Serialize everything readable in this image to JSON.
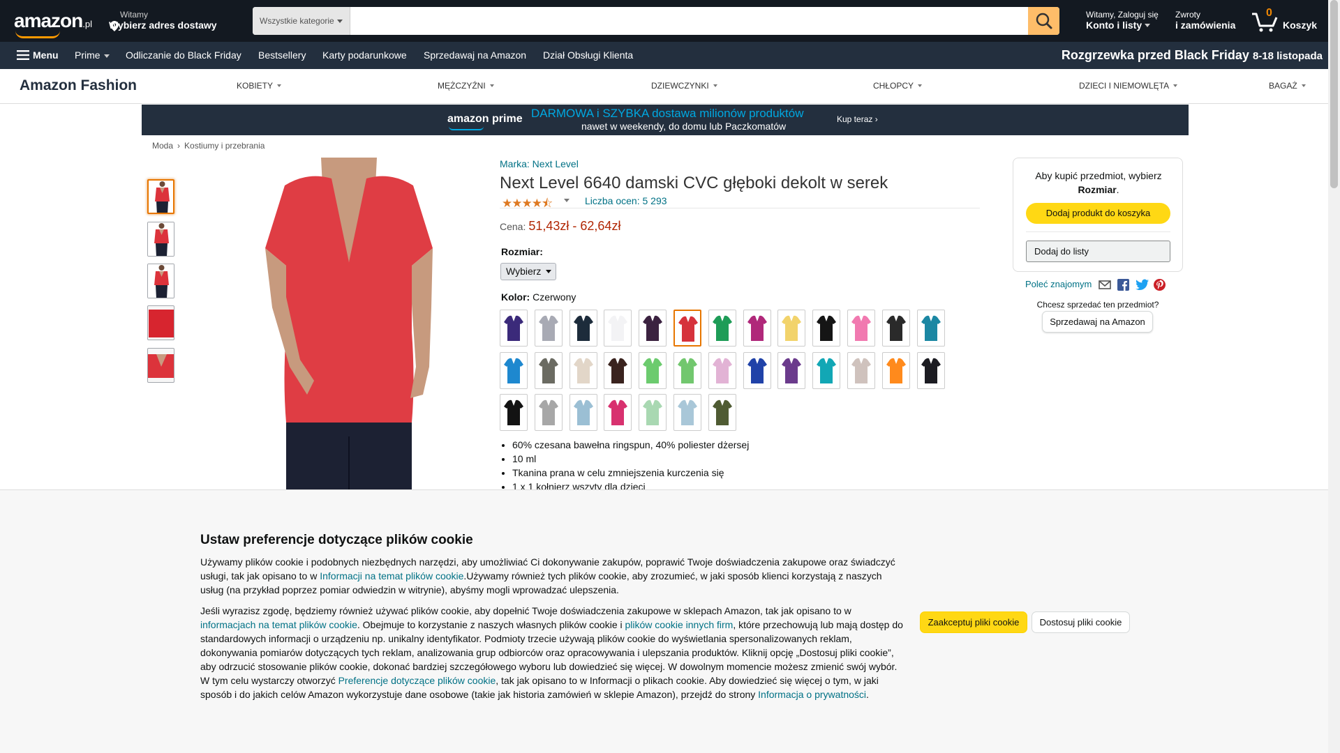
{
  "header": {
    "logo": "amazon",
    "logo_tld": ".pl",
    "deliver_line1": "Witamy",
    "deliver_line2": "Wybierz adres dostawy",
    "search_category": "Wszystkie kategorie",
    "search_placeholder": "",
    "account_line1": "Witamy, Zaloguj się",
    "account_line2": "Konto i listy",
    "returns_line1": "Zwroty",
    "returns_line2": "i zamówienia",
    "cart_count": "0",
    "cart_label": "Koszyk"
  },
  "nav": {
    "menu": "Menu",
    "items": [
      "Prime",
      "Odliczanie do Black Friday",
      "Bestsellery",
      "Karty podarunkowe",
      "Sprzedawaj na Amazon",
      "Dział Obsługi Klienta"
    ],
    "promo": "Rozgrzewka przed Black Friday",
    "promo_dates": "8-18 listopada"
  },
  "fashion": {
    "brand": "Amazon Fashion",
    "categories": [
      "KOBIETY",
      "MĘŻCZYŹNI",
      "DZIEWCZYNKI",
      "CHŁOPCY",
      "DZIECI I NIEMOWLĘTA",
      "BAGAŻ"
    ]
  },
  "prime_banner": {
    "logo": "amazon prime",
    "line1": "DARMOWA i SZYBKA dostawa milionów produktów",
    "line2": "nawet w weekendy, do domu lub Paczkomatów",
    "cta": "Kup teraz ›"
  },
  "breadcrumb": [
    "Moda",
    "Kostiumy i przebrania"
  ],
  "product": {
    "brand_link": "Marka: Next Level",
    "title": "Next Level 6640 damski CVC głęboki dekolt w serek",
    "stars": "★★★★⯪",
    "rating_count": "Liczba ocen: 5 293",
    "price_label": "Cena:",
    "price": "51,43zł - 62,64zł",
    "size_label": "Rozmiar:",
    "size_value": "Wybierz",
    "color_label": "Kolor:",
    "color_value": "Czerwony",
    "swatches": [
      "#3b2a7a",
      "#a8aab4",
      "#1d2c3b",
      "#f3f3f5",
      "#3b2240",
      "#d6323c",
      "#1e9c57",
      "#b0287a",
      "#f2d36b",
      "#151515",
      "#f179b0",
      "#2a2a2a",
      "#1b87a3",
      "#1e88cf",
      "#6b6b62",
      "#e2d6c8",
      "#3a231e",
      "#6ccb6e",
      "#72c76e",
      "#e2b3d5",
      "#2042a8",
      "#6b3b8c",
      "#12a7b5",
      "#cfc2bd",
      "#ff8a1c",
      "#1c1c22",
      "#131313",
      "#a7a7a7",
      "#9bbfd4",
      "#d8316f",
      "#a9d8b2",
      "#a9c7d8",
      "#4f5b33"
    ],
    "bullets": [
      "60% czesana bawełna ringspun, 40% poliester dżersej",
      "10 ml",
      "Tkanina prana w celu zmniejszenia kurczenia się",
      "1 x 1 kołnierz wszyty dla dzieci"
    ]
  },
  "buybox": {
    "line1": "Aby kupić przedmiot, wybierz",
    "line2": "Rozmiar",
    "add_to_cart": "Dodaj produkt do koszyka",
    "add_to_list": "Dodaj do listy",
    "share": "Poleć znajomym",
    "sell_question": "Chcesz sprzedać ten przedmiot?",
    "sell_button": "Sprzedawaj na Amazon"
  },
  "cookie": {
    "title": "Ustaw preferencje dotyczące plików cookie",
    "p1a": "Używamy plików cookie i podobnych niezbędnych narzędzi, aby umożliwiać Ci dokonywanie zakupów, poprawić Twoje doświadczenia zakupowe oraz świadczyć usługi, tak jak opisano to w ",
    "p1link": "Informacji na temat plików cookie",
    "p1b": ".Używamy również tych plików cookie, aby zrozumieć, w jaki sposób klienci korzystają z naszych usług (na przykład poprzez pomiar odwiedzin w witrynie), abyśmy mogli wprowadzać ulepszenia.",
    "p2a": "Jeśli wyrazisz zgodę, będziemy również używać plików cookie, aby dopełnić Twoje doświadczenia zakupowe w sklepach Amazon, tak jak opisano to w ",
    "p2link1": "informacjach na temat plików cookie",
    "p2b": ". Obejmuje to korzystanie z naszych własnych plików cookie i ",
    "p2link2": "plików cookie innych firm",
    "p2c": ", które przechowują lub mają dostęp do standardowych informacji o urządzeniu np. unikalny identyfikator. Podmioty trzecie używają plików cookie do wyświetlania spersonalizowanych reklam, dokonywania pomiarów dotyczących tych reklam, analizowania grup odbiorców oraz opracowywania i ulepszania produktów. Kliknij opcję „Dostosuj pliki cookie”, aby odrzucić stosowanie plików cookie, dokonać bardziej szczegółowego wyboru lub dowiedzieć się więcej. W dowolnym momencie możesz zmienić swój wybór. W tym celu wystarczy otworzyć ",
    "p2link3": "Preferencje dotyczące plików cookie",
    "p2d": ", tak jak opisano to w Informacji o plikach cookie. Aby dowiedzieć się więcej o tym, w jaki sposób i do jakich celów Amazon wykorzystuje dane osobowe (takie jak historia zamówień w sklepie Amazon), przejdź do strony ",
    "p2link4": "Informacja o prywatności",
    "p2e": ".",
    "accept": "Zaakceptuj pliki cookie",
    "customize": "Dostosuj pliki cookie"
  },
  "colors": {
    "nav_dark": "#131921",
    "nav_main": "#232f3e",
    "accent": "#ff9900",
    "link": "#007185",
    "price": "#b12704",
    "button_yellow": "#ffd814"
  }
}
